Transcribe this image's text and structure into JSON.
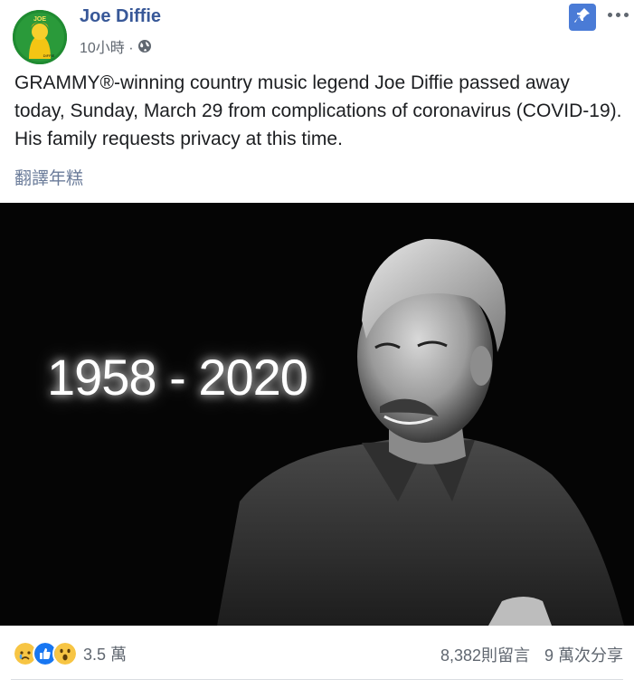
{
  "post": {
    "page_name": "Joe Diffie",
    "time": "10小時 ·",
    "privacy_icon": "globe-icon",
    "text": "GRAMMY®-winning country music legend Joe Diffie passed away today, Sunday, March 29 from complications of coronavirus (COVID-19). His family requests privacy at this time.",
    "translate_link": "翻譯年糕",
    "photo_caption": "1958 - 2020",
    "avatar_text": "JOE DIFFIE"
  },
  "actions": {
    "pin_icon": "pin-icon",
    "more_icon": "more-options-icon"
  },
  "engagement": {
    "reaction_icons": [
      "sad-reaction-icon",
      "like-reaction-icon",
      "wow-reaction-icon"
    ],
    "reaction_count": "3.5 萬",
    "comments": "8,382則留言",
    "shares": "9 萬次分享"
  },
  "colors": {
    "link_blue": "#385898",
    "pin_blue": "#4a7bd6",
    "meta_gray": "#606770",
    "photo_bg": "#050505"
  }
}
